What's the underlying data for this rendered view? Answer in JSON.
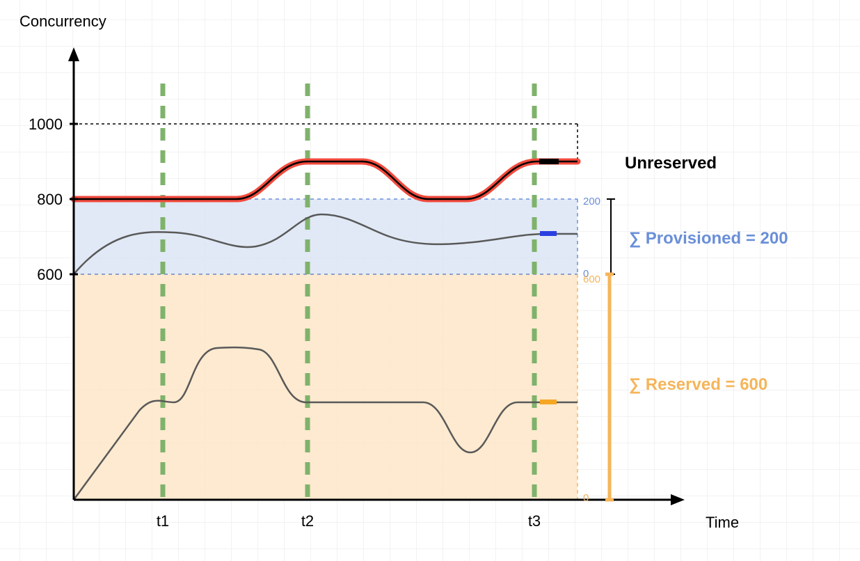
{
  "chart_data": {
    "type": "area",
    "title": "",
    "xlabel": "Time",
    "ylabel": "Concurrency",
    "ylim": [
      0,
      1000
    ],
    "y_ticks": [
      600,
      800,
      1000
    ],
    "x_categories": [
      "t1",
      "t2",
      "t3"
    ],
    "regions": [
      {
        "name": "Reserved",
        "sum": 600,
        "range": [
          0,
          600
        ],
        "color": "#f7c27f"
      },
      {
        "name": "Provisioned",
        "sum": 200,
        "range": [
          600,
          800
        ],
        "color": "#a9c0e6"
      },
      {
        "name": "Unreserved",
        "range": [
          800,
          1000
        ]
      }
    ],
    "right_axis_reserved_ticks": [
      0,
      600
    ],
    "right_axis_provisioned_ticks": [
      0,
      200
    ],
    "annotations": {
      "unreserved_label": "Unreserved",
      "provisioned_label": "∑ Provisioned = 200",
      "reserved_label": "∑ Reserved = 600"
    },
    "series": [
      {
        "name": "reserved_usage",
        "approx_points": [
          [
            0,
            0
          ],
          [
            0.12,
            240
          ],
          [
            0.2,
            260
          ],
          [
            0.28,
            400
          ],
          [
            0.36,
            400
          ],
          [
            0.44,
            270
          ],
          [
            0.5,
            260
          ],
          [
            0.6,
            260
          ],
          [
            0.7,
            260
          ],
          [
            0.78,
            130
          ],
          [
            0.84,
            260
          ],
          [
            0.9,
            260
          ],
          [
            1,
            260
          ]
        ]
      },
      {
        "name": "provisioned_usage",
        "approx_points": [
          [
            0,
            600
          ],
          [
            0.1,
            700
          ],
          [
            0.2,
            710
          ],
          [
            0.3,
            670
          ],
          [
            0.45,
            760
          ],
          [
            0.55,
            720
          ],
          [
            0.7,
            690
          ],
          [
            0.85,
            700
          ],
          [
            0.95,
            710
          ],
          [
            1,
            710
          ]
        ]
      },
      {
        "name": "unreserved_boundary",
        "approx_points": [
          [
            0,
            800
          ],
          [
            0.3,
            800
          ],
          [
            0.4,
            900
          ],
          [
            0.55,
            900
          ],
          [
            0.65,
            800
          ],
          [
            0.75,
            800
          ],
          [
            0.85,
            900
          ],
          [
            0.95,
            900
          ],
          [
            1,
            900
          ]
        ]
      }
    ]
  },
  "colors": {
    "reserved_fill": "#fde6c8",
    "reserved_line": "#f5b55a",
    "provisioned_fill": "#dce5f5",
    "provisioned_line": "#6a8fd8",
    "accent_red": "#f24a3d",
    "accent_green": "#7fb26b",
    "accent_blue": "#2a3fe0",
    "accent_orange": "#f5a623"
  }
}
